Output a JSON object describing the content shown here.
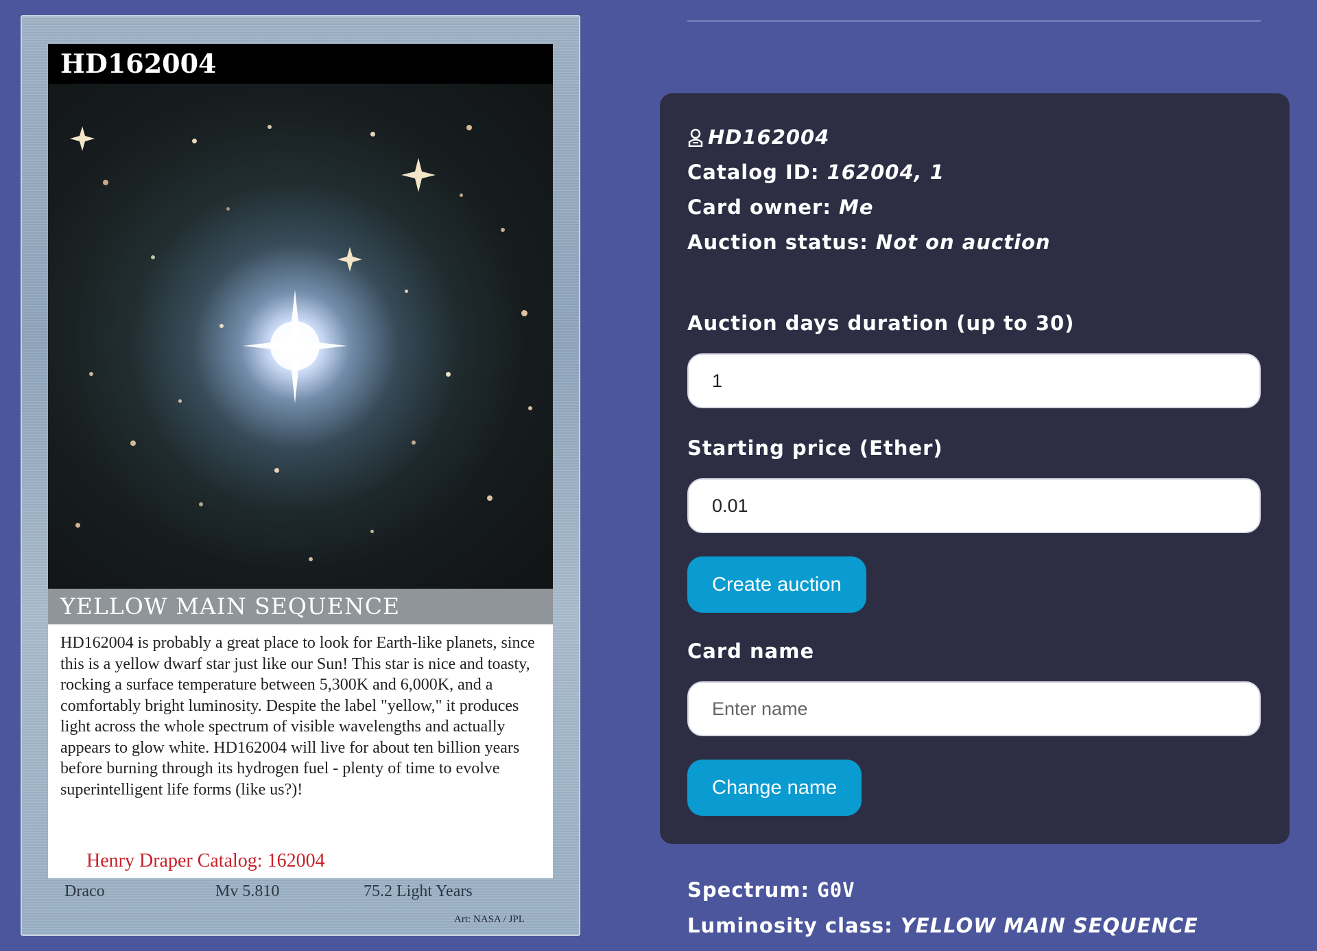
{
  "card": {
    "title": "HD162004",
    "luminosity_band": "YELLOW MAIN SEQUENCE",
    "description": "HD162004 is probably a great place to look for Earth-like planets, since this is a yellow dwarf star just like our Sun! This star is nice and toasty, rocking a surface temperature between 5,300K and 6,000K, and a comfortably bright luminosity. Despite the label \"yellow,\" it produces light across the whole spectrum of visible wavelengths and actually appears to glow white. HD162004 will live for about ten billion years before burning through its hydrogen fuel - plenty of time to evolve superintelligent life forms (like us?)!",
    "catalog_line": "Henry Draper Catalog: 162004",
    "constellation": "Draco",
    "magnitude": "Mv 5.810",
    "distance": "75.2 Light Years",
    "credit": "Art: NASA / JPL"
  },
  "info": {
    "owner_icon": "user-badge-icon",
    "name": "HD162004",
    "catalog_label": "Catalog ID:",
    "catalog_value": "162004, 1",
    "owner_label": "Card owner:",
    "owner_value": "Me",
    "auction_label": "Auction status:",
    "auction_value": "Not on auction"
  },
  "form": {
    "duration_label": "Auction days duration (up to 30)",
    "duration_value": "1",
    "price_label": "Starting price (Ether)",
    "price_value": "0.01",
    "create_button": "Create auction",
    "name_label": "Card name",
    "name_placeholder": "Enter name",
    "change_button": "Change name"
  },
  "details": {
    "spectrum_label": "Spectrum:",
    "spectrum_value": "G0V",
    "luminosity_label": "Luminosity class:",
    "luminosity_value": "YELLOW MAIN SEQUENCE"
  },
  "colors": {
    "background": "#4c569c",
    "panel": "#2d2e44",
    "button": "#0a9bd0",
    "catalog_red": "#c8222b"
  }
}
